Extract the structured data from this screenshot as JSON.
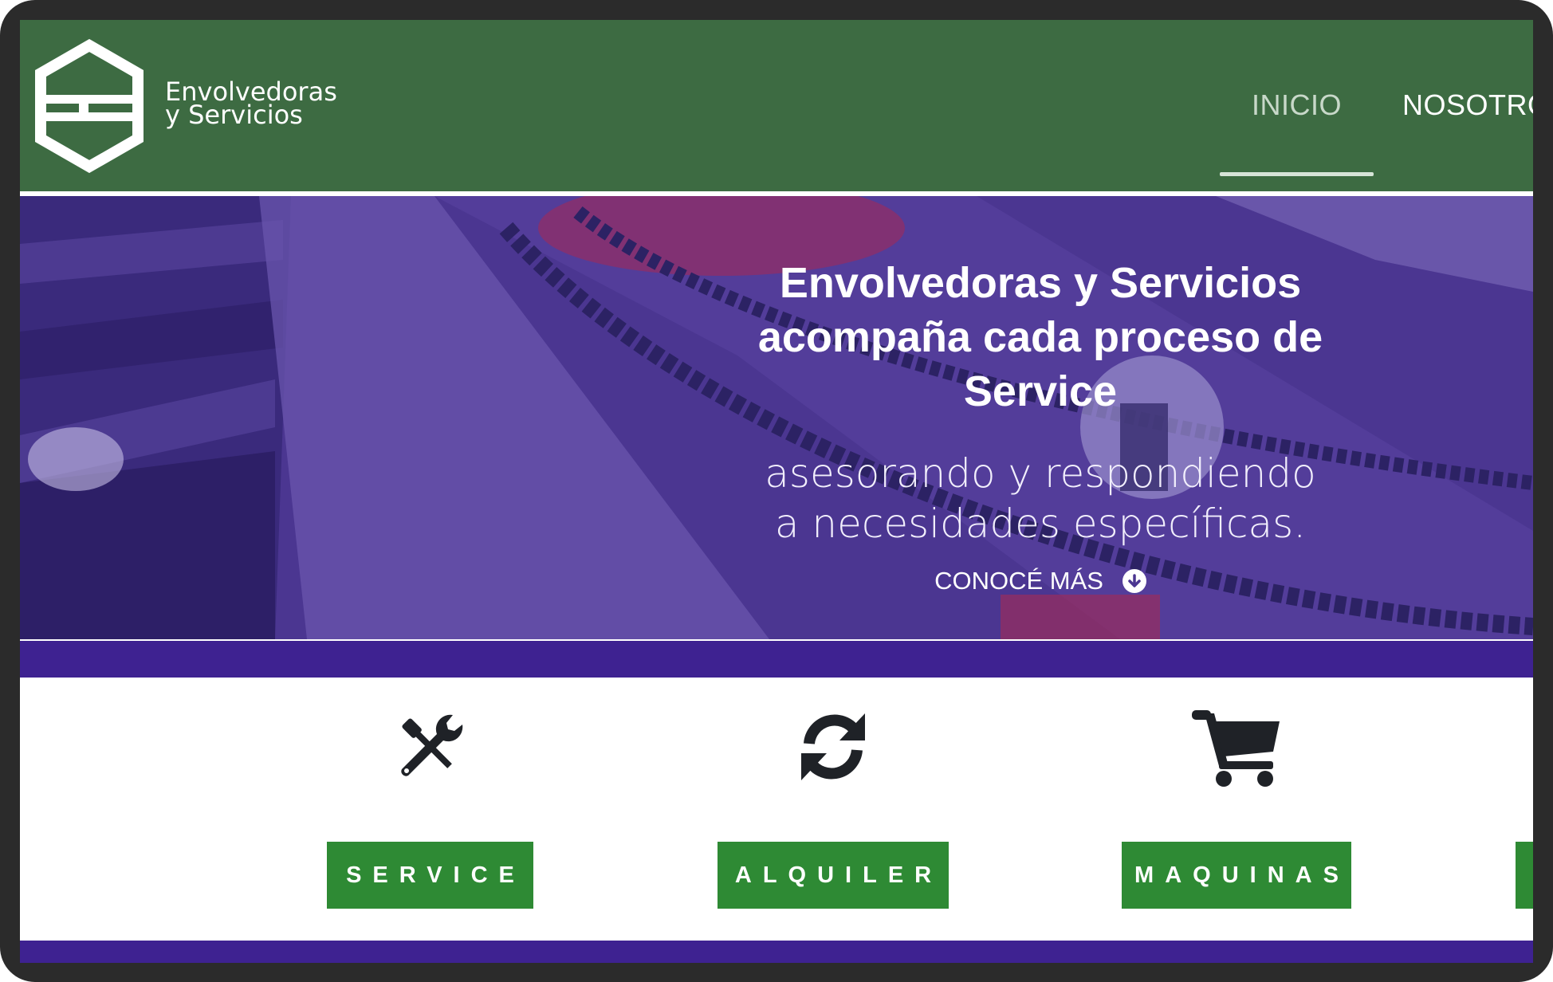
{
  "brand": {
    "line1": "Envolvedoras",
    "line2": "y Servicios"
  },
  "nav": {
    "items": [
      {
        "label": "INICIO",
        "active": true
      },
      {
        "label": "NOSOTROS",
        "active": false
      }
    ]
  },
  "hero": {
    "title_lines": [
      "Envolvedoras y Servicios",
      "acompaña cada proceso de",
      "Service"
    ],
    "subtitle_lines": [
      "asesorando y respondiendo",
      "a necesidades específicas."
    ],
    "cta_label": "CONOCÉ MÁS"
  },
  "services": [
    {
      "label": "SERVICE",
      "icon": "tools-icon"
    },
    {
      "label": "ALQUILER",
      "icon": "sync-icon"
    },
    {
      "label": "MAQUINAS",
      "icon": "cart-icon"
    }
  ],
  "colors": {
    "header_bg": "#3d6b42",
    "hero_overlay": "#4b3691",
    "band": "#3e2291",
    "button_green": "#2e8a34"
  }
}
